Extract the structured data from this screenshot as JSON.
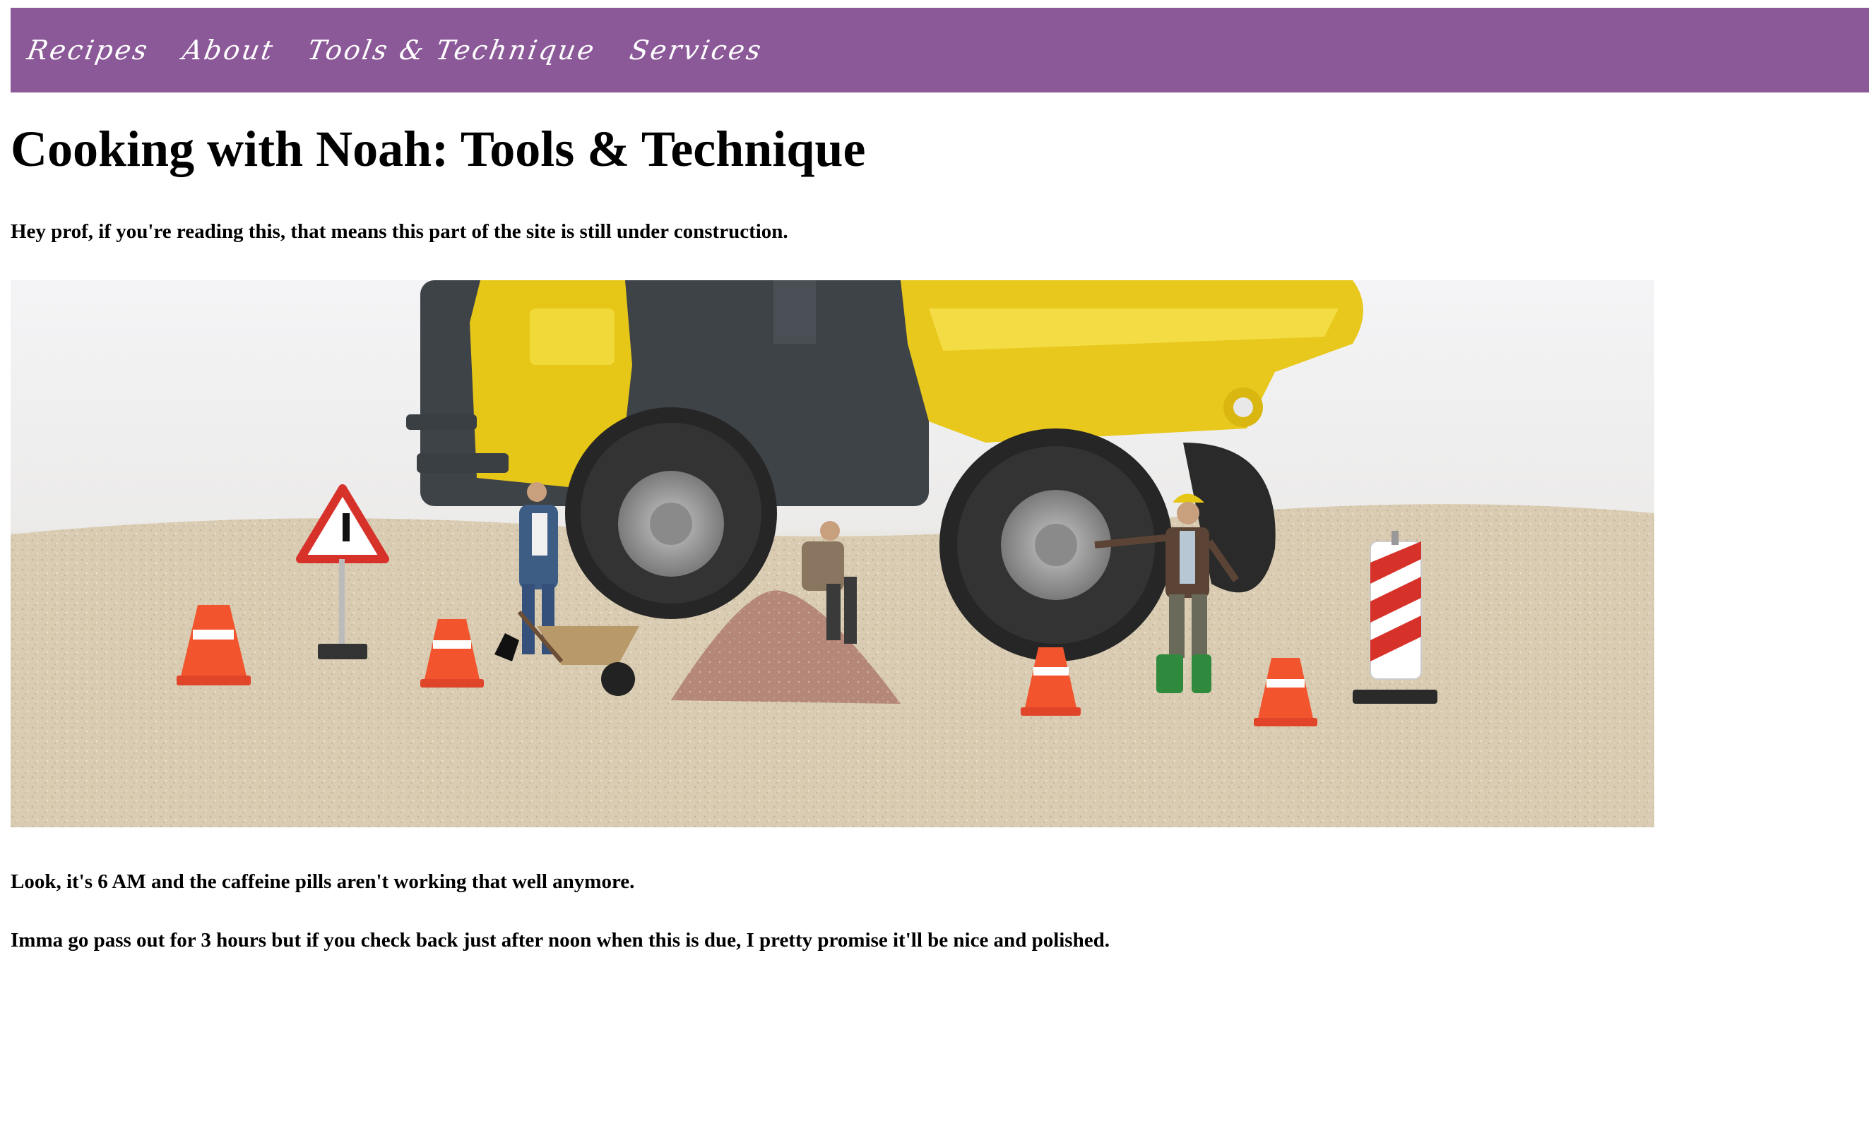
{
  "nav": {
    "items": [
      {
        "label": "Recipes"
      },
      {
        "label": "About"
      },
      {
        "label": "Tools & Technique"
      },
      {
        "label": "Services"
      }
    ]
  },
  "page": {
    "title": "Cooking with Noah: Tools & Technique",
    "paragraphs": [
      "Hey prof, if you're reading this, that means this part of the site is still under construction.",
      "Look, it's 6 AM and the caffeine pills aren't working that well anymore.",
      "Imma go pass out for 3 hours but if you check back just after noon when this is due, I pretty promise it'll be nice and polished."
    ]
  },
  "colors": {
    "nav_background": "#8b5898",
    "nav_text": "#ffffff",
    "truck_yellow": "#e6c718",
    "cone_orange": "#f2542d",
    "sand": "#d8ccb4"
  }
}
